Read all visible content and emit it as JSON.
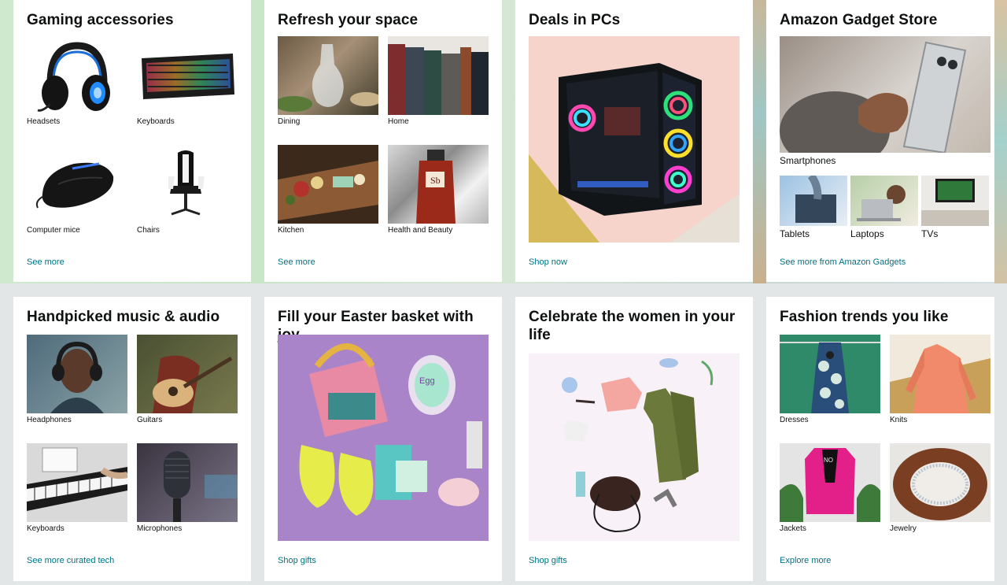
{
  "cards": [
    {
      "title": "Gaming accessories",
      "items": [
        {
          "label": "Headsets"
        },
        {
          "label": "Keyboards"
        },
        {
          "label": "Computer mice"
        },
        {
          "label": "Chairs"
        }
      ],
      "link": "See more"
    },
    {
      "title": "Refresh your space",
      "items": [
        {
          "label": "Dining"
        },
        {
          "label": "Home"
        },
        {
          "label": "Kitchen"
        },
        {
          "label": "Health and Beauty"
        }
      ],
      "link": "See more"
    },
    {
      "title": "Deals in PCs",
      "link": "Shop now"
    },
    {
      "title": "Amazon Gadget Store",
      "main_label": "Smartphones",
      "items": [
        {
          "label": "Tablets"
        },
        {
          "label": "Laptops"
        },
        {
          "label": "TVs"
        }
      ],
      "link": "See more from Amazon Gadgets"
    },
    {
      "title": "Handpicked music & audio",
      "items": [
        {
          "label": "Headphones"
        },
        {
          "label": "Guitars"
        },
        {
          "label": "Keyboards"
        },
        {
          "label": "Microphones"
        }
      ],
      "link": "See more curated tech"
    },
    {
      "title": "Fill your Easter basket with joy",
      "link": "Shop gifts"
    },
    {
      "title": "Celebrate the women in your life",
      "link": "Shop gifts"
    },
    {
      "title": "Fashion trends you like",
      "items": [
        {
          "label": "Dresses"
        },
        {
          "label": "Knits"
        },
        {
          "label": "Jackets"
        },
        {
          "label": "Jewelry"
        }
      ],
      "link": "Explore more"
    }
  ],
  "colors": {
    "link": "#007185",
    "text": "#0f1111",
    "page_bg": "#e3e6e6",
    "card_bg": "#ffffff"
  }
}
